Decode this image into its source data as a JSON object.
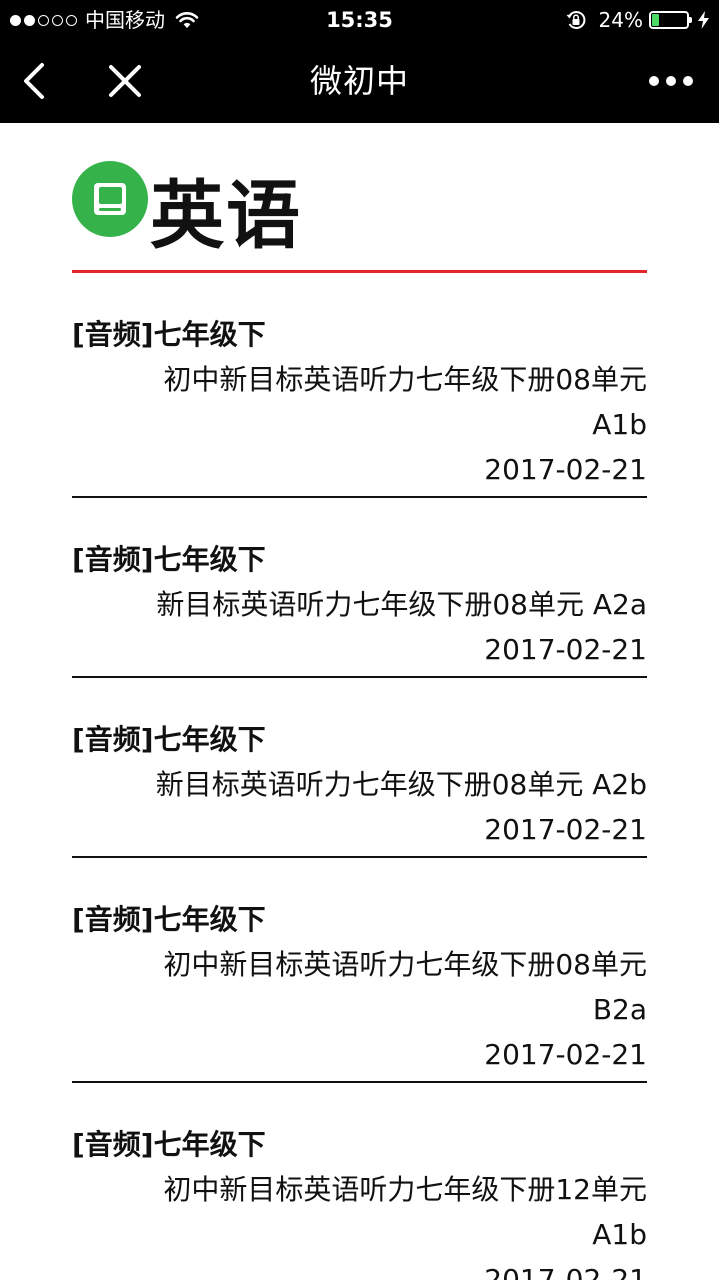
{
  "status_bar": {
    "carrier": "中国移动",
    "time": "15:35",
    "battery_percent": "24%",
    "battery_level": 0.24,
    "signal_strength": 2,
    "signal_total": 5
  },
  "nav_bar": {
    "title": "微初中",
    "icons": [
      "back-chevron-icon",
      "close-icon",
      "more-dots-icon"
    ]
  },
  "section": {
    "title": "英语",
    "icon": "book-icon",
    "icon_color": "#35b34a",
    "divider_color": "#e3262c"
  },
  "articles": [
    {
      "category": "[音频]七年级下",
      "title": "初中新目标英语听力七年级下册08单元 A1b",
      "date": "2017-02-21"
    },
    {
      "category": "[音频]七年级下",
      "title": "新目标英语听力七年级下册08单元 A2a",
      "date": "2017-02-21"
    },
    {
      "category": "[音频]七年级下",
      "title": "新目标英语听力七年级下册08单元 A2b",
      "date": "2017-02-21"
    },
    {
      "category": "[音频]七年级下",
      "title": "初中新目标英语听力七年级下册08单元 B2a",
      "date": "2017-02-21"
    },
    {
      "category": "[音频]七年级下",
      "title": "初中新目标英语听力七年级下册12单元 A1b",
      "date": "2017-02-21"
    }
  ]
}
